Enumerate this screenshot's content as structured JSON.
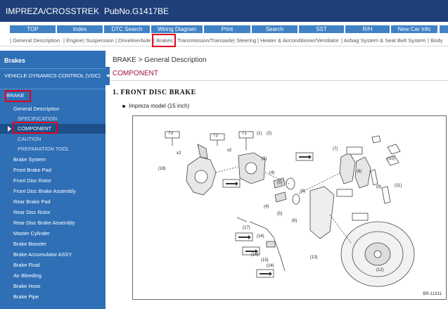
{
  "header": {
    "model": "IMPREZA/CROSSTREK",
    "pub_no": "PubNo.G1417BE"
  },
  "nav": [
    {
      "label": "TOP"
    },
    {
      "label": "Index"
    },
    {
      "label": "DTC Search"
    },
    {
      "label": "Wiring Diagram"
    },
    {
      "label": "Print"
    },
    {
      "label": "Search"
    },
    {
      "label": "SST"
    },
    {
      "label": "R/H"
    },
    {
      "label": "New Car Info"
    }
  ],
  "subnav": [
    {
      "label": "| General Description"
    },
    {
      "label": "| Engine"
    },
    {
      "label": "| Suspension"
    },
    {
      "label": "| Driveline/Axle"
    },
    {
      "label": "| Brakes"
    },
    {
      "label": "| Transmission/Transaxle"
    },
    {
      "label": "| Steering"
    },
    {
      "label": "| Heater & Airconditioner/Ventilator"
    },
    {
      "label": "| Airbag System & Seat Belt System"
    },
    {
      "label": "| Body"
    }
  ],
  "subnav_selected": "Brakes",
  "sidebar": {
    "title": "Brakes",
    "vdc": "VEHICLE DYNAMICS CONTROL (VDC)",
    "brake": "BRAKE",
    "sub_items": [
      {
        "label": "General Description"
      },
      {
        "label": "SPECIFICATION"
      },
      {
        "label": "COMPONENT",
        "active": true
      },
      {
        "label": "CAUTION"
      },
      {
        "label": "PREPARATION TOOL"
      }
    ],
    "items": [
      {
        "label": "Brake System"
      },
      {
        "label": "Front Brake Pad"
      },
      {
        "label": "Front Disc Rotor"
      },
      {
        "label": "Front Disc Brake Assembly"
      },
      {
        "label": "Rear Brake Pad"
      },
      {
        "label": "Rear Disc Rotor"
      },
      {
        "label": "Rear Disc Brake Assembly"
      },
      {
        "label": "Master Cylinder"
      },
      {
        "label": "Brake Booster"
      },
      {
        "label": "Brake Accumulator ASSY"
      },
      {
        "label": "Brake Fluid"
      },
      {
        "label": "Air Bleeding"
      },
      {
        "label": "Brake Hose"
      },
      {
        "label": "Brake Pipe"
      }
    ]
  },
  "content": {
    "breadcrumb": "BRAKE > General Description",
    "title": "COMPONENT",
    "section": "1. FRONT DISC BRAKE",
    "bullet": "Impreza model (15 inch)",
    "figure": {
      "code": "BR-11331",
      "torque_tags": [
        "T3",
        "T2",
        "T1"
      ],
      "callouts": [
        "(1)",
        "(2)",
        "(3)",
        "(4)",
        "(4)",
        "(5)",
        "(5)",
        "(6)",
        "(6)",
        "(7)",
        "(8)",
        "(9)",
        "(10)",
        "(11)",
        "(12)",
        "(13)",
        "(14)",
        "(14)",
        "(15)",
        "(16)",
        "(17)",
        "(18)",
        "x2",
        "x2"
      ]
    }
  },
  "colors": {
    "header": "#1e3f78",
    "nav_button": "#3f82c6",
    "sidebar": "#2e6fb6",
    "highlight": "#e3001b",
    "title": "#a0113c"
  }
}
